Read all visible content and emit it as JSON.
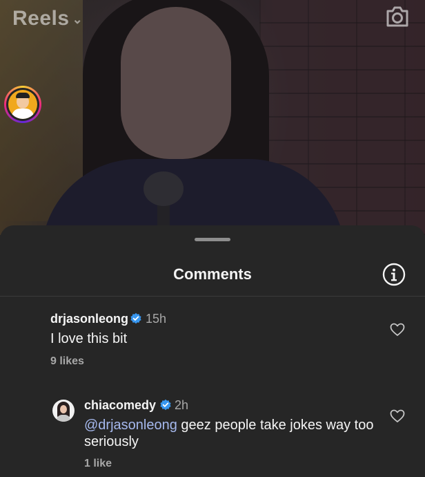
{
  "header": {
    "title": "Reels",
    "chevron": "chevron-down-icon",
    "camera_icon": "camera-icon"
  },
  "sheet": {
    "title": "Comments",
    "info_icon": "info-icon"
  },
  "comments": [
    {
      "username": "drjasonleong",
      "verified": true,
      "time": "15h",
      "text": "I love this bit",
      "likes": "9 likes"
    }
  ],
  "reply": {
    "username": "chiacomedy",
    "verified": true,
    "time": "2h",
    "mention": "@drjasonleong",
    "text": " geez people take jokes way too seriously",
    "likes": "1 like"
  },
  "colors": {
    "sheet_bg": "#262626",
    "verified_blue": "#3897f0",
    "mention": "#a6b9ee",
    "muted": "#a8a8a8"
  }
}
